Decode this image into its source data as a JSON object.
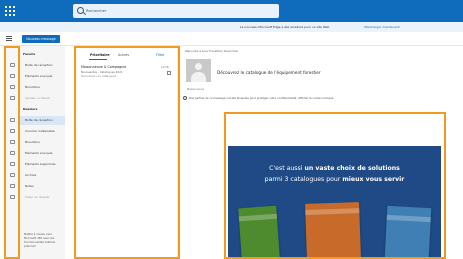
{
  "search": {
    "placeholder": "Rechercher"
  },
  "infobar": {
    "text": "Le nouveau Microsoft Edge a été amélioré pour ce site Web",
    "link": "Télécharger maintenant"
  },
  "toolbar": {
    "new_message_label": "Nouveau message"
  },
  "nav": {
    "items": [
      {
        "label": "Favoris",
        "type": "header"
      },
      {
        "label": "Boîte de réception",
        "type": "item"
      },
      {
        "label": "Éléments envoyés",
        "type": "item"
      },
      {
        "label": "Brouillons",
        "type": "item"
      },
      {
        "label": "Ajouter un favori",
        "type": "muted"
      },
      {
        "label": "Dossiers",
        "type": "header"
      },
      {
        "label": "Boîte de réception",
        "type": "selected"
      },
      {
        "label": "Courrier indésirable",
        "type": "item"
      },
      {
        "label": "Brouillons",
        "type": "item"
      },
      {
        "label": "Éléments envoyés",
        "type": "item"
      },
      {
        "label": "Éléments supprimés",
        "type": "item"
      },
      {
        "label": "Archive",
        "type": "item"
      },
      {
        "label": "Notes",
        "type": "item"
      },
      {
        "label": "Créer un dossier",
        "type": "muted"
      }
    ],
    "footer": "Mettre à niveau vers Microsoft 365 avec les fonctionnalités Outlook premium"
  },
  "message_list": {
    "tab_focused": "Prioritaire",
    "tab_other": "Autres",
    "filter_label": "Filtre",
    "items": [
      {
        "sender": "Maisonneuve & Compagnie",
        "subject": "Nouveautés - Catalogues 2021",
        "preview": "Découvrez nos catalogues",
        "date": "12:08"
      }
    ]
  },
  "reading_pane": {
    "actions": "Répondre à tous   Transférer   Supprimer",
    "subject": "Découvrez le catalogue de l'équipement forestier",
    "meta": "Maisonneuve",
    "warning": "Des parties de ce message ont été bloquées pour protéger votre confidentialité. Afficher le contenu bloqué"
  },
  "banner": {
    "line1_pre": "C'est aussi",
    "line1_bold": "un vaste choix de solutions",
    "line2_pre": "parmi 3 catalogues pour",
    "line2_bold": "mieux vous servir"
  },
  "colors": {
    "brand_blue": "#0f6cbd",
    "highlight_orange": "#f29a1e",
    "banner_blue": "#1f4a86"
  }
}
